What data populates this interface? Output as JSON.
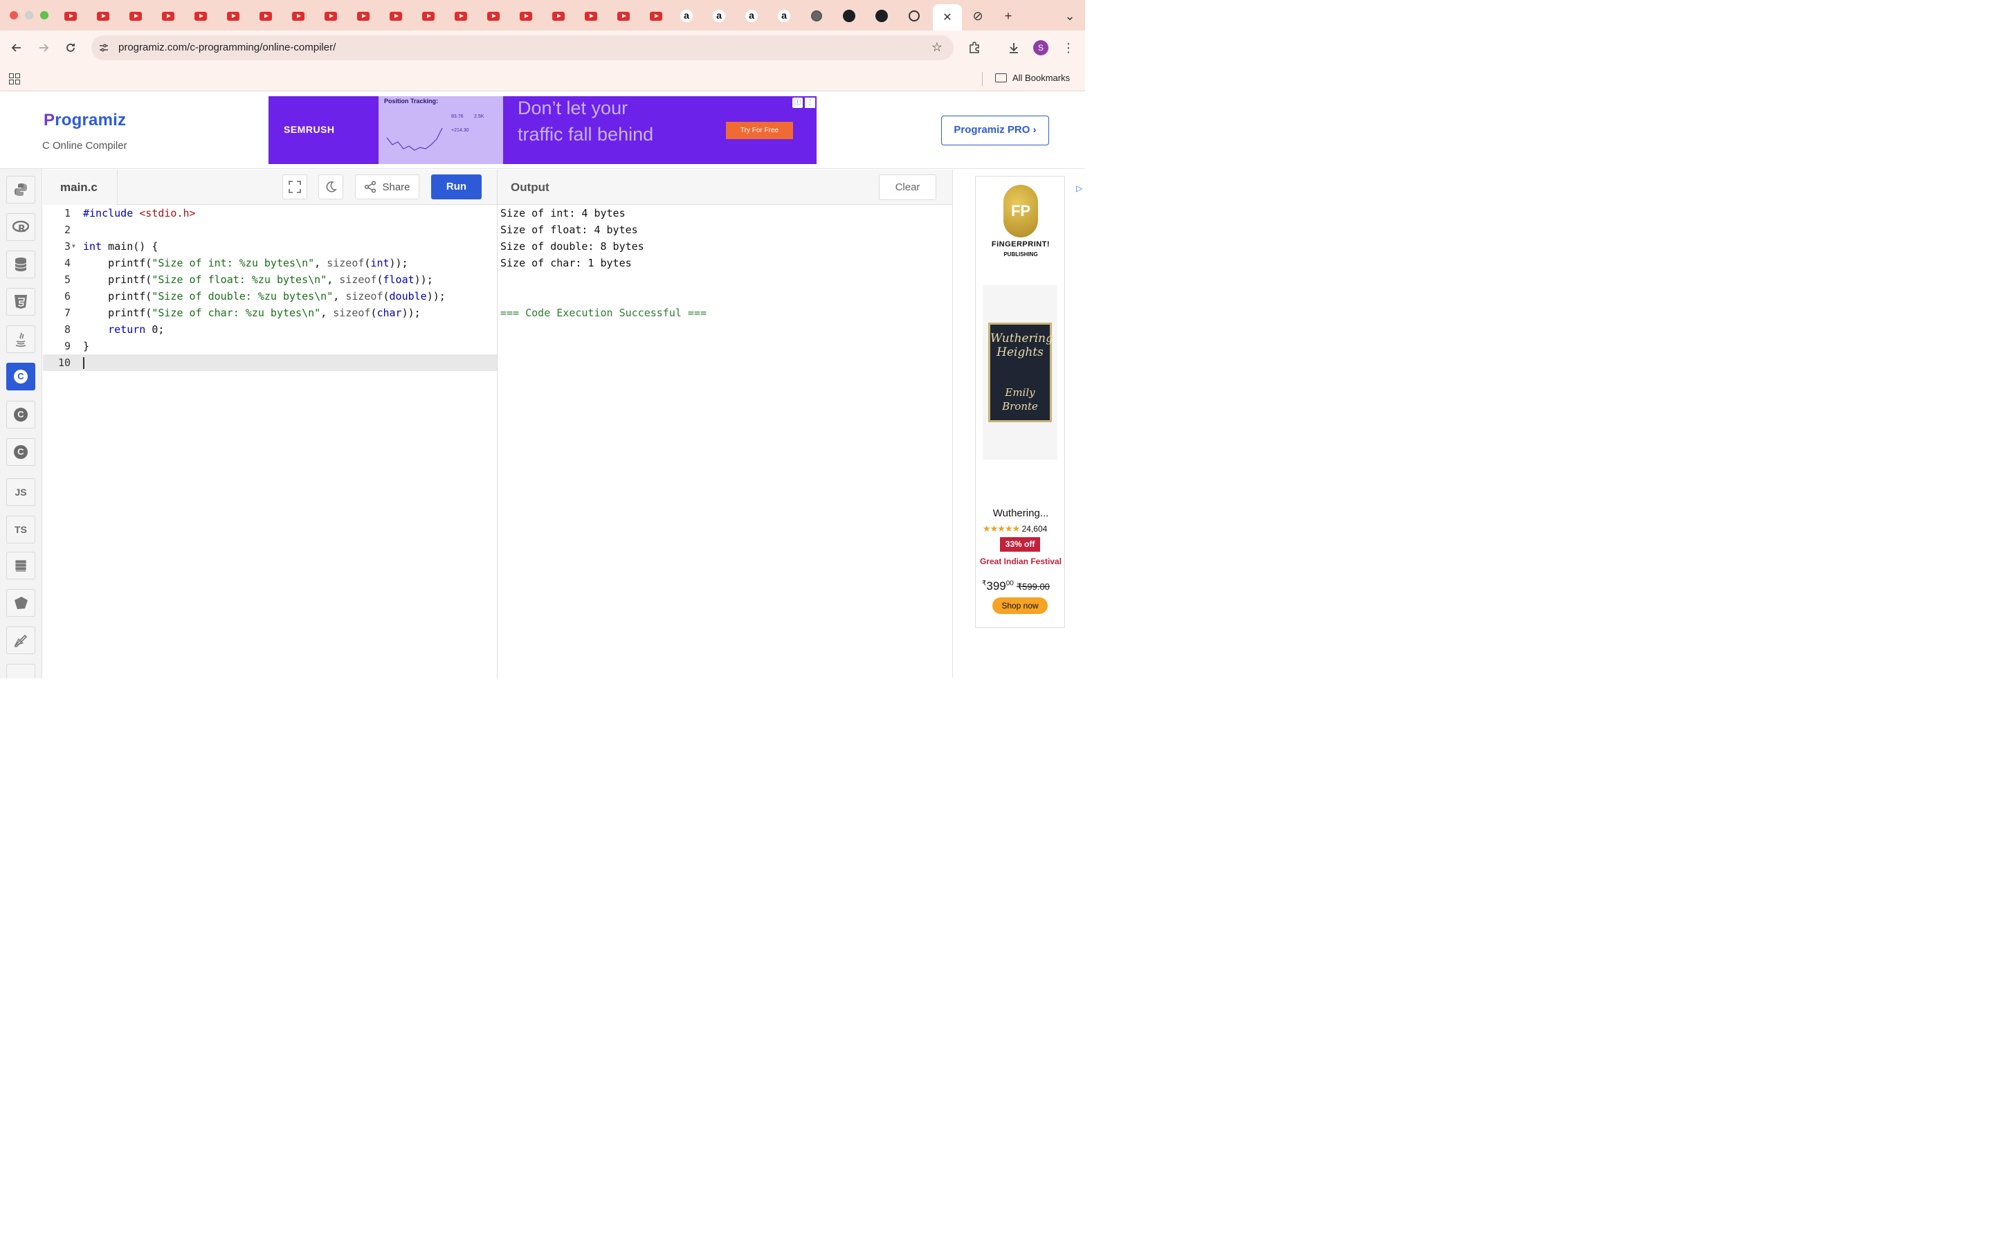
{
  "browser": {
    "url": "programiz.com/c-programming/online-compiler/",
    "all_bookmarks": "All Bookmarks",
    "profile_initial": "S",
    "active_tab_close": "✕",
    "new_tab": "+",
    "menu_chevron": "⌄"
  },
  "site": {
    "logo_initial": "P",
    "logo_text": "rogramiz",
    "subtitle": "C Online Compiler",
    "pro_button": "Programiz PRO ›"
  },
  "top_ad": {
    "brand": "SEMRUSH",
    "shot_title": "Position Tracking:",
    "shot_metric_1": "83.76",
    "shot_metric_2": "2.5K",
    "shot_metric_3": "+214.30",
    "headline_1": "Don’t let your",
    "headline_2": "traffic fall behind",
    "cta": "Try For Free"
  },
  "left_rail": {
    "js": "JS",
    "ts": "TS"
  },
  "editor": {
    "filename": "main.c",
    "share_label": "Share",
    "run_label": "Run",
    "lines": [
      {
        "n": "1",
        "parts": [
          [
            "kw",
            "#include "
          ],
          [
            "str-red",
            "<stdio.h>"
          ]
        ]
      },
      {
        "n": "2",
        "parts": []
      },
      {
        "n": "3",
        "parts": [
          [
            "kw",
            "int"
          ],
          [
            "plain",
            " main() {"
          ]
        ]
      },
      {
        "n": "4",
        "parts": [
          [
            "plain",
            "    printf("
          ],
          [
            "str",
            "\"Size of int: %zu bytes\\n\""
          ],
          [
            "plain",
            ", "
          ],
          [
            "fn",
            "sizeof"
          ],
          [
            "plain",
            "("
          ],
          [
            "kw",
            "int"
          ],
          [
            "plain",
            "));"
          ]
        ]
      },
      {
        "n": "5",
        "parts": [
          [
            "plain",
            "    printf("
          ],
          [
            "str",
            "\"Size of float: %zu bytes\\n\""
          ],
          [
            "plain",
            ", "
          ],
          [
            "fn",
            "sizeof"
          ],
          [
            "plain",
            "("
          ],
          [
            "kw",
            "float"
          ],
          [
            "plain",
            "));"
          ]
        ]
      },
      {
        "n": "6",
        "parts": [
          [
            "plain",
            "    printf("
          ],
          [
            "str",
            "\"Size of double: %zu bytes\\n\""
          ],
          [
            "plain",
            ", "
          ],
          [
            "fn",
            "sizeof"
          ],
          [
            "plain",
            "("
          ],
          [
            "kw",
            "double"
          ],
          [
            "plain",
            "));"
          ]
        ]
      },
      {
        "n": "7",
        "parts": [
          [
            "plain",
            "    printf("
          ],
          [
            "str",
            "\"Size of char: %zu bytes\\n\""
          ],
          [
            "plain",
            ", "
          ],
          [
            "fn",
            "sizeof"
          ],
          [
            "plain",
            "("
          ],
          [
            "kw",
            "char"
          ],
          [
            "plain",
            "));"
          ]
        ]
      },
      {
        "n": "8",
        "parts": [
          [
            "plain",
            "    "
          ],
          [
            "kw",
            "return"
          ],
          [
            "plain",
            " 0;"
          ]
        ]
      },
      {
        "n": "9",
        "parts": [
          [
            "plain",
            "}"
          ]
        ]
      },
      {
        "n": "10",
        "parts": []
      }
    ]
  },
  "output": {
    "title": "Output",
    "clear_label": "Clear",
    "lines": [
      "Size of int: 4 bytes",
      "Size of float: 4 bytes",
      "Size of double: 8 bytes",
      "Size of char: 1 bytes",
      "",
      "",
      "=== Code Execution Successful ==="
    ]
  },
  "side_ad": {
    "publisher_mark": "FP",
    "publisher": "FiNGERPRINT!",
    "publisher_sub": "PUBLISHING",
    "cover_title": "Wuthering Heights",
    "cover_author": "Emily Bronte",
    "book_title": "Wuthering...",
    "stars": "★★★★★",
    "rating_count": "24,604",
    "discount": "33% off",
    "festival": "Great Indian Festival",
    "price_symbol": "₹",
    "price_main": "399",
    "price_fraction": "00",
    "price_old": "₹599.00",
    "shop_now": "Shop now"
  },
  "colors": {
    "accent": "#2d5bd8",
    "tabstrip": "#f7d9cf",
    "ad_purple": "#6c22e8",
    "success": "#2e7d32"
  }
}
